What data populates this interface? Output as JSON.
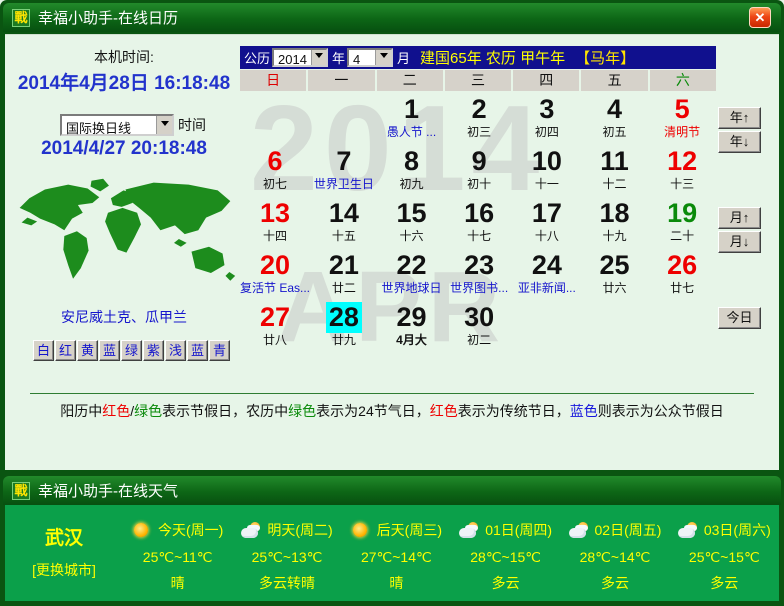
{
  "icons": {
    "app_glyph": "戰",
    "close_glyph": "✕"
  },
  "calendar_window": {
    "title": "幸福小助手-在线日历"
  },
  "weather_window": {
    "title": "幸福小助手-在线天气"
  },
  "left_panel": {
    "local_time_label": "本机时间:",
    "local_datetime": "2014年4月28日  16:18:48",
    "timezone_selected": "国际换日线",
    "timezone_suffix": "时间",
    "timezone_time": "2014/4/27 20:18:48",
    "map_caption": "安尼威土克、瓜甲兰",
    "color_buttons": [
      "白",
      "红",
      "黄",
      "蓝",
      "绿",
      "紫",
      "浅",
      "蓝",
      "青"
    ]
  },
  "calendar": {
    "header": {
      "era_label": "公历",
      "year_value": "2014",
      "year_suffix": "年",
      "month_value": "4",
      "month_suffix": "月",
      "era_text": "建国65年 农历 甲午年",
      "zodiac": "【马年】"
    },
    "weekdays": [
      {
        "label": "日",
        "cls": "red"
      },
      {
        "label": "一"
      },
      {
        "label": "二"
      },
      {
        "label": "三"
      },
      {
        "label": "四"
      },
      {
        "label": "五"
      },
      {
        "label": "六",
        "cls": "green"
      }
    ],
    "watermark_year": "2014",
    "watermark_month": "APR",
    "cells": [
      {},
      {},
      {
        "day": "1",
        "sub": "愚人节 ...",
        "sub_class": "blue"
      },
      {
        "day": "2",
        "sub": "初三"
      },
      {
        "day": "3",
        "sub": "初四"
      },
      {
        "day": "4",
        "sub": "初五"
      },
      {
        "day": "5",
        "day_class": "red",
        "sub": "清明节",
        "sub_class": "red"
      },
      {
        "day": "6",
        "day_class": "red",
        "sub": "初七"
      },
      {
        "day": "7",
        "sub": "世界卫生日",
        "sub_class": "blue"
      },
      {
        "day": "8",
        "sub": "初九"
      },
      {
        "day": "9",
        "sub": "初十"
      },
      {
        "day": "10",
        "sub": "十一"
      },
      {
        "day": "11",
        "sub": "十二"
      },
      {
        "day": "12",
        "day_class": "red",
        "sub": "十三"
      },
      {
        "day": "13",
        "day_class": "red",
        "sub": "十四"
      },
      {
        "day": "14",
        "sub": "十五"
      },
      {
        "day": "15",
        "sub": "十六"
      },
      {
        "day": "16",
        "sub": "十七"
      },
      {
        "day": "17",
        "sub": "十八"
      },
      {
        "day": "18",
        "sub": "十九"
      },
      {
        "day": "19",
        "day_class": "green",
        "sub": "二十"
      },
      {
        "day": "20",
        "day_class": "red",
        "sub": "复活节 Eas...",
        "sub_class": "blue"
      },
      {
        "day": "21",
        "sub": "廿二"
      },
      {
        "day": "22",
        "sub": "世界地球日",
        "sub_class": "blue"
      },
      {
        "day": "23",
        "sub": "世界图书...",
        "sub_class": "blue"
      },
      {
        "day": "24",
        "sub": "亚非新闻...",
        "sub_class": "blue"
      },
      {
        "day": "25",
        "sub": "廿六"
      },
      {
        "day": "26",
        "day_class": "red",
        "sub": "廿七"
      },
      {
        "day": "27",
        "day_class": "red",
        "sub": "廿八"
      },
      {
        "day": "28",
        "day_class": "hl",
        "sub": "廿九"
      },
      {
        "day": "29",
        "sub": "4月大",
        "sub_class": "bold"
      },
      {
        "day": "30",
        "sub": "初二"
      },
      {},
      {},
      {}
    ],
    "nav": {
      "year_up": "年↑",
      "year_down": "年↓",
      "month_up": "月↑",
      "month_down": "月↓",
      "today": "今日"
    }
  },
  "footnote": {
    "segments": [
      {
        "text": "阳历中",
        "cls": "fk"
      },
      {
        "text": "红色",
        "cls": "fr"
      },
      {
        "text": "/",
        "cls": "fk"
      },
      {
        "text": "绿色",
        "cls": "fg"
      },
      {
        "text": "表示节假日，农历中",
        "cls": "fk"
      },
      {
        "text": "绿色",
        "cls": "fg"
      },
      {
        "text": "表示为24节气日，",
        "cls": "fk"
      },
      {
        "text": "红色",
        "cls": "fr"
      },
      {
        "text": "表示为传统节日，",
        "cls": "fk"
      },
      {
        "text": "蓝色",
        "cls": "fb"
      },
      {
        "text": "则表示为公众节假日",
        "cls": "fk"
      }
    ]
  },
  "weather": {
    "city": "武汉",
    "change_city": "[更换城市]",
    "days": [
      {
        "icon": "sun",
        "label": "今天(周一)",
        "temp": "25℃~11℃",
        "cond": "晴"
      },
      {
        "icon": "sun-cloud",
        "label": "明天(周二)",
        "temp": "25℃~13℃",
        "cond": "多云转晴"
      },
      {
        "icon": "sun",
        "label": "后天(周三)",
        "temp": "27℃~14℃",
        "cond": "晴"
      },
      {
        "icon": "sun-cloud",
        "label": "01日(周四)",
        "temp": "28℃~15℃",
        "cond": "多云"
      },
      {
        "icon": "sun-cloud",
        "label": "02日(周五)",
        "temp": "28℃~14℃",
        "cond": "多云"
      },
      {
        "icon": "sun-cloud",
        "label": "03日(周六)",
        "temp": "25℃~15℃",
        "cond": "多云"
      }
    ],
    "colors": {
      "panel_green": "#0ba04a",
      "title_green": "#0d6616",
      "text_yellow": "#ffff00"
    }
  }
}
